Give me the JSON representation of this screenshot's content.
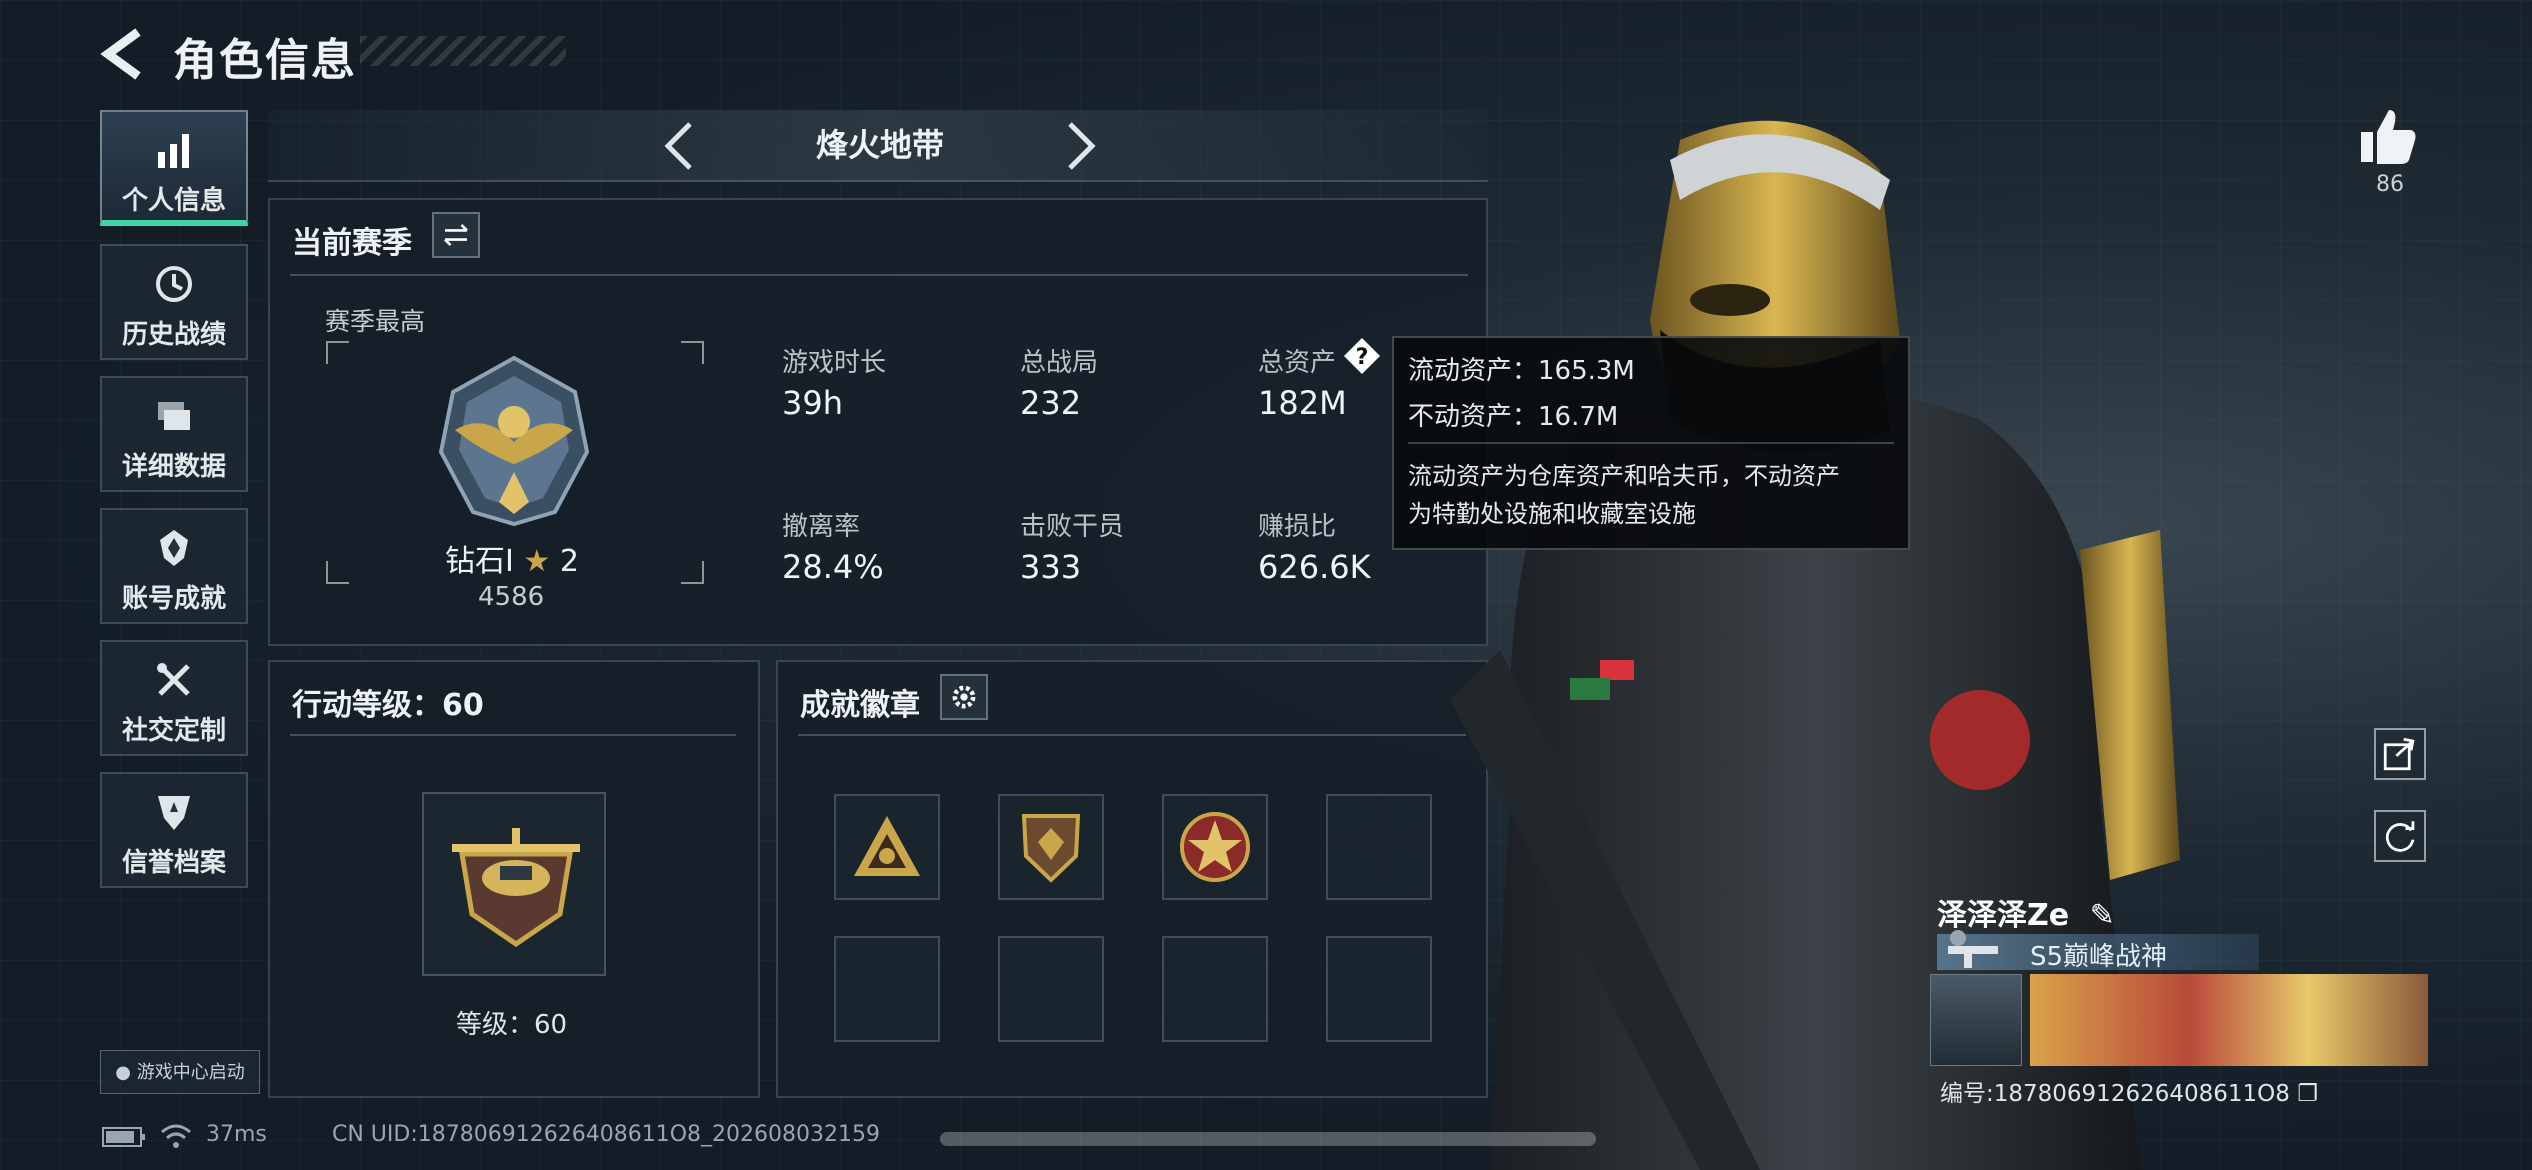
{
  "header": {
    "title": "角色信息"
  },
  "nav": {
    "items": [
      {
        "label": "个人信息",
        "icon": "bar-chart-icon",
        "active": true
      },
      {
        "label": "历史战绩",
        "icon": "clock-icon"
      },
      {
        "label": "详细数据",
        "icon": "folders-icon"
      },
      {
        "label": "账号成就",
        "icon": "achievement-icon"
      },
      {
        "label": "社交定制",
        "icon": "tools-icon"
      },
      {
        "label": "信誉档案",
        "icon": "credit-shield-icon"
      }
    ],
    "game_center": "游戏中心启动"
  },
  "mode": {
    "title": "烽火地带"
  },
  "season": {
    "title": "当前赛季",
    "best_label": "赛季最高",
    "rank_name": "钻石I",
    "rank_stars": "2",
    "rank_score": "4586",
    "stats": [
      {
        "label": "游戏时长",
        "value": "39h"
      },
      {
        "label": "总战局",
        "value": "232"
      },
      {
        "label": "总资产",
        "value": "182M"
      },
      {
        "label": "撤离率",
        "value": "28.4%"
      },
      {
        "label": "击败干员",
        "value": "333"
      },
      {
        "label": "赚损比",
        "value": "626.6K"
      }
    ]
  },
  "tooltip": {
    "liquid": "流动资产：165.3M",
    "fixed": "不动资产：16.7M",
    "desc_line1": "流动资产为仓库资产和哈夫币，不动资产",
    "desc_line2": "为特勤处设施和收藏室设施"
  },
  "action_level": {
    "title": "行动等级：60",
    "level_text": "等级：60",
    "level": 60
  },
  "achievements": {
    "title": "成就徽章",
    "badges": [
      "triangle-badge",
      "shield-badge",
      "star-medal-badge"
    ]
  },
  "player": {
    "likes": "86",
    "name": "泽泽泽Ze",
    "title": "S5巅峰战神",
    "id_text": "编号:187806912626408611O8"
  },
  "footer": {
    "ping": "37ms",
    "uid": "CN UID:187806912626408611O8_202608032159"
  },
  "colors": {
    "accent": "#3fd5a6",
    "gold": "#c9a64a"
  }
}
